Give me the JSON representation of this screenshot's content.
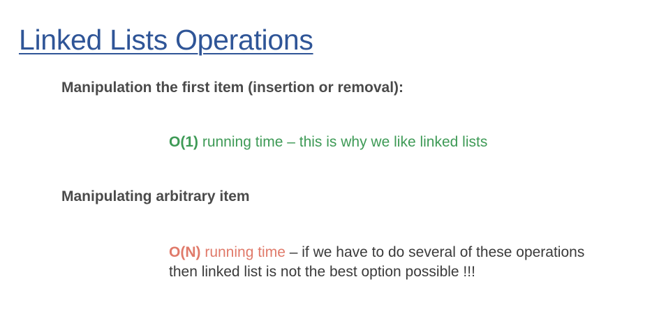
{
  "slide": {
    "title": "Linked Lists Operations"
  },
  "section_first": {
    "heading": "Manipulation the first item (insertion or removal):",
    "complexity": "O(1)",
    "description": " running time – this is why we like linked lists"
  },
  "section_arbitrary": {
    "heading": "Manipulating arbitrary item",
    "complexity": "O(N)",
    "running_time": " running time",
    "rest_line1": " – if we have to do several of these operations",
    "line2": "then linked list is not the best option possible !!!"
  },
  "colors": {
    "title": "#2f5597",
    "heading": "#4a4a4a",
    "good": "#3e9a56",
    "bad": "#e07a6a",
    "body_text": "#3a3a3a"
  }
}
